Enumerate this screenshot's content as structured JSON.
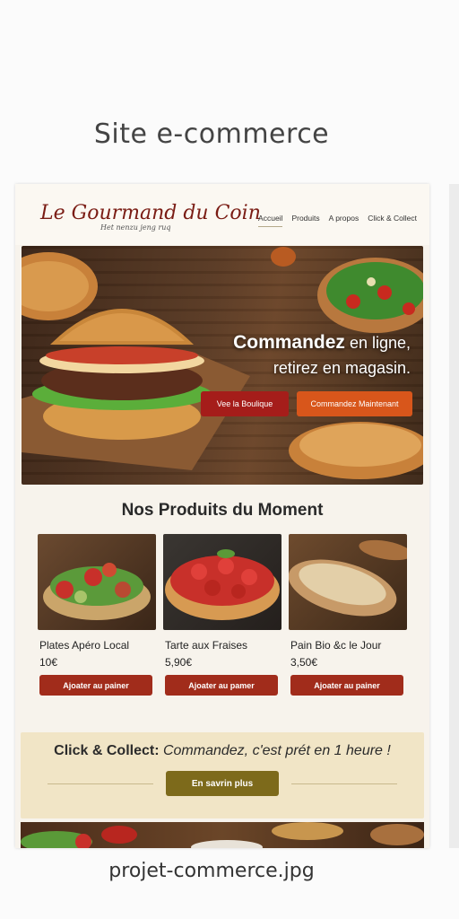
{
  "page": {
    "title": "Site e-commerce",
    "caption": "projet-commerce.jpg"
  },
  "header": {
    "logo": "Le Gourmand du Coin",
    "tagline": "Het nenzu jeng ruq",
    "nav": [
      "Accueil",
      "Produits",
      "A propos",
      "Click & Collect"
    ]
  },
  "hero": {
    "title_bold": "Commandez",
    "title_rest": " en ligne,",
    "title_line2": "retirez en magasin.",
    "btn_boutique": "Vee la Boulique",
    "btn_commander": "Commandez Maintenant"
  },
  "products_section": {
    "title": "Nos Produits du Moment",
    "items": [
      {
        "name": "Plates Apéro Local",
        "price": "10€",
        "button": "Ajoater au painer"
      },
      {
        "name": "Tarte aux Fraises",
        "price": "5,90€",
        "button": "Ajoater au pamer"
      },
      {
        "name": "Pain Bio &c le Jour",
        "price": "3,50€",
        "button": "Ajoater au painer"
      }
    ]
  },
  "click_collect": {
    "bold": "Click & Collect:",
    "italic": " Commandez, c'est prét en 1 heure !",
    "button": "En savrin plus"
  },
  "colors": {
    "brand": "#7a1c14",
    "btn_red": "#a51d1a",
    "btn_orange": "#d8561b",
    "btn_gold": "#7d6a1b",
    "banner": "#f1e5c6"
  }
}
